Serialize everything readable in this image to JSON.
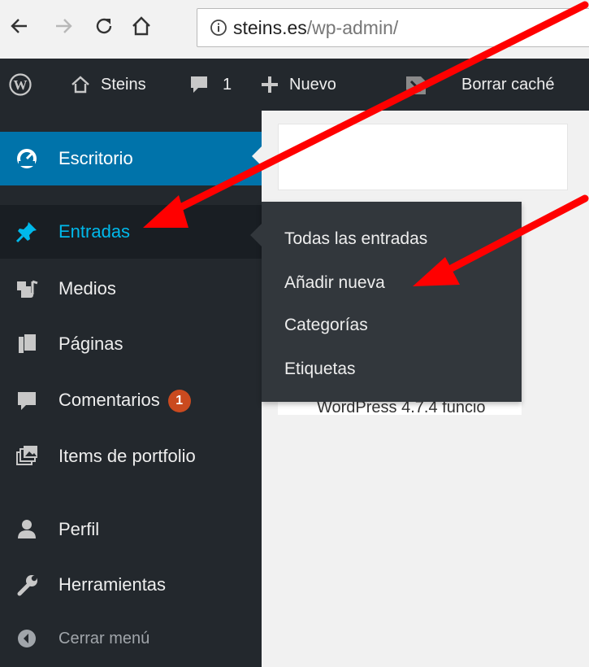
{
  "browser": {
    "url_domain": "steins.es",
    "url_path": "/wp-admin/"
  },
  "adminbar": {
    "site_name": "Steins",
    "comments_count": "1",
    "new_label": "Nuevo",
    "cache_label": "Borrar caché"
  },
  "menu": {
    "items": [
      {
        "label": "Escritorio",
        "icon": "dashboard-icon"
      },
      {
        "label": "Entradas",
        "icon": "pin-icon"
      },
      {
        "label": "Medios",
        "icon": "media-icon"
      },
      {
        "label": "Páginas",
        "icon": "pages-icon"
      },
      {
        "label": "Comentarios",
        "icon": "comment-icon",
        "badge": "1"
      },
      {
        "label": "Items de portfolio",
        "icon": "portfolio-icon"
      },
      {
        "label": "Perfil",
        "icon": "user-icon"
      },
      {
        "label": "Herramientas",
        "icon": "wrench-icon"
      },
      {
        "label": "Cerrar menú",
        "icon": "collapse-icon"
      }
    ]
  },
  "submenu": {
    "items": [
      {
        "label": "Todas las entradas"
      },
      {
        "label": "Añadir nueva"
      },
      {
        "label": "Categorías"
      },
      {
        "label": "Etiquetas"
      }
    ]
  },
  "content": {
    "peek_text": "WordPress 4.7.4 funcio"
  },
  "colors": {
    "admin_dark": "#23282d",
    "current_blue": "#0073aa",
    "open_text": "#00b9eb",
    "flyout_bg": "#32373c",
    "badge": "#ca4a1f",
    "annotation": "#ff0000"
  }
}
